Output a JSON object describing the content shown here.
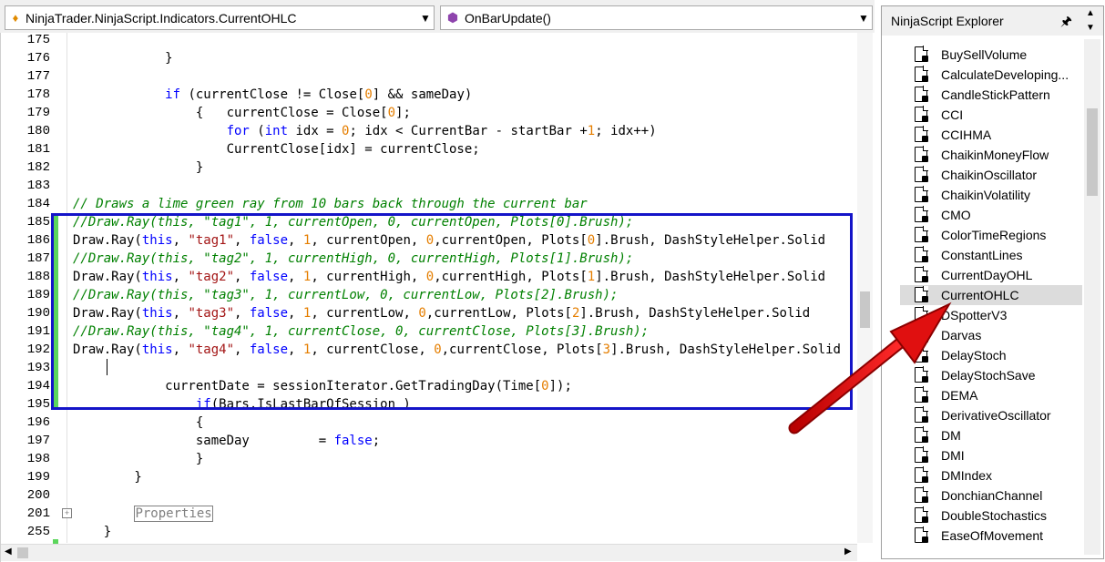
{
  "toolbar": {
    "class_combo": "NinjaTrader.NinjaScript.Indicators.CurrentOHLC",
    "method_combo": "OnBarUpdate()"
  },
  "editor": {
    "lines": [
      {
        "n": "175",
        "html": ""
      },
      {
        "n": "176",
        "html": "            }"
      },
      {
        "n": "177",
        "html": ""
      },
      {
        "n": "178",
        "html": "            <span class=\"kw\">if</span> (currentClose != Close[<span class=\"num\">0</span>] &amp;&amp; sameDay)"
      },
      {
        "n": "179",
        "html": "                {   currentClose = Close[<span class=\"num\">0</span>];"
      },
      {
        "n": "180",
        "html": "                    <span class=\"kw\">for</span> (<span class=\"kw\">int</span> idx = <span class=\"num\">0</span>; idx &lt; CurrentBar - startBar +<span class=\"num\">1</span>; idx++)"
      },
      {
        "n": "181",
        "html": "                    CurrentClose[idx] = currentClose;"
      },
      {
        "n": "182",
        "html": "                }"
      },
      {
        "n": "183",
        "html": ""
      },
      {
        "n": "184",
        "html": "<span class=\"cmt\">// Draws a lime green ray from 10 bars back through the current bar</span>"
      },
      {
        "n": "185",
        "html": "<span class=\"cmt\">//Draw.Ray(this, \"tag1\", 1, currentOpen, 0, currentOpen, Plots[0].Brush);</span>"
      },
      {
        "n": "186",
        "html": "Draw.Ray(<span class=\"kw\">this</span>, <span class=\"str\">\"tag1\"</span>, <span class=\"kw\">false</span>, <span class=\"num\">1</span>, currentOpen, <span class=\"num\">0</span>,currentOpen, Plots[<span class=\"num\">0</span>].Brush, DashStyleHelper.Solid"
      },
      {
        "n": "187",
        "html": "<span class=\"cmt\">//Draw.Ray(this, \"tag2\", 1, currentHigh, 0, currentHigh, Plots[1].Brush);</span>"
      },
      {
        "n": "188",
        "html": "Draw.Ray(<span class=\"kw\">this</span>, <span class=\"str\">\"tag2\"</span>, <span class=\"kw\">false</span>, <span class=\"num\">1</span>, currentHigh, <span class=\"num\">0</span>,currentHigh, Plots[<span class=\"num\">1</span>].Brush, DashStyleHelper.Solid"
      },
      {
        "n": "189",
        "html": "<span class=\"cmt\">//Draw.Ray(this, \"tag3\", 1, currentLow, 0, currentLow, Plots[2].Brush);</span>"
      },
      {
        "n": "190",
        "html": "Draw.Ray(<span class=\"kw\">this</span>, <span class=\"str\">\"tag3\"</span>, <span class=\"kw\">false</span>, <span class=\"num\">1</span>, currentLow, <span class=\"num\">0</span>,currentLow, Plots[<span class=\"num\">2</span>].Brush, DashStyleHelper.Solid"
      },
      {
        "n": "191",
        "html": "<span class=\"cmt\">//Draw.Ray(this, \"tag4\", 1, currentClose, 0, currentClose, Plots[3].Brush);</span>"
      },
      {
        "n": "192",
        "html": "Draw.Ray(<span class=\"kw\">this</span>, <span class=\"str\">\"tag4\"</span>, <span class=\"kw\">false</span>, <span class=\"num\">1</span>, currentClose, <span class=\"num\">0</span>,currentClose, Plots[<span class=\"num\">3</span>].Brush, DashStyleHelper.Solid"
      },
      {
        "n": "193",
        "html": ""
      },
      {
        "n": "194",
        "html": "            currentDate = sessionIterator.GetTradingDay(Time[<span class=\"num\">0</span>]);"
      },
      {
        "n": "195",
        "html": "                <span class=\"kw\">if</span>(Bars.IsLastBarOfSession )"
      },
      {
        "n": "196",
        "html": "                {"
      },
      {
        "n": "197",
        "html": "                sameDay         = <span class=\"kw\">false</span>;"
      },
      {
        "n": "198",
        "html": "                }"
      },
      {
        "n": "199",
        "html": "        }"
      },
      {
        "n": "200",
        "html": ""
      },
      {
        "n": "201",
        "html": "        <span style=\"color:#808080;border:1px solid #808080;padding:0 0\">Properties</span>"
      },
      {
        "n": "255",
        "html": "    }"
      }
    ]
  },
  "explorer": {
    "title": "NinjaScript Explorer",
    "pin_icon": "pin-icon",
    "items": [
      "BuySellVolume",
      "CalculateDeveloping...",
      "CandleStickPattern",
      "CCI",
      "CCIHMA",
      "ChaikinMoneyFlow",
      "ChaikinOscillator",
      "ChaikinVolatility",
      "CMO",
      "ColorTimeRegions",
      "ConstantLines",
      "CurrentDayOHL",
      "CurrentOHLC",
      "DSpotterV3",
      "Darvas",
      "DelayStoch",
      "DelayStochSave",
      "DEMA",
      "DerivativeOscillator",
      "DM",
      "DMI",
      "DMIndex",
      "DonchianChannel",
      "DoubleStochastics",
      "EaseOfMovement"
    ],
    "selected": "CurrentOHLC"
  },
  "colors": {
    "highlight_box": "#1414c8",
    "arrow": "#e01010",
    "keyword": "#0000ff",
    "string": "#a31515",
    "number": "#e57e00",
    "comment": "#008000"
  }
}
